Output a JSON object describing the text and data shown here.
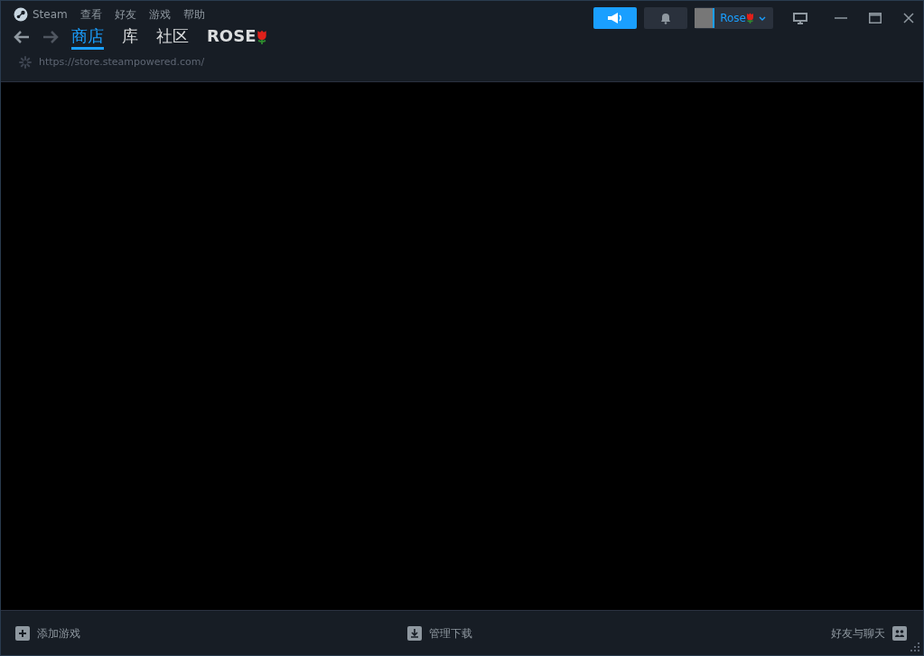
{
  "menu": [
    "Steam",
    "查看",
    "好友",
    "游戏",
    "帮助"
  ],
  "nav_tabs": [
    {
      "label": "商店",
      "selected": true
    },
    {
      "label": "库",
      "selected": false
    },
    {
      "label": "社区",
      "selected": false
    },
    {
      "label": "ROSE",
      "selected": false
    }
  ],
  "url": "https://store.steampowered.com/",
  "account": {
    "name": "Rose"
  },
  "bottom_bar": {
    "add_game": "添加游戏",
    "downloads": "管理下载",
    "friends": "好友与聊天"
  }
}
